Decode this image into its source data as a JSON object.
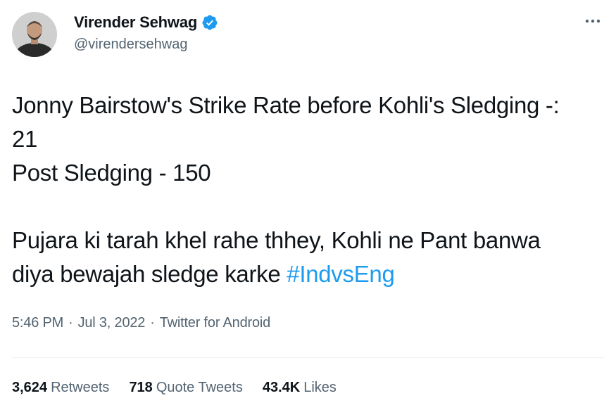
{
  "author": {
    "display_name": "Virender Sehwag",
    "handle": "@virendersehwag",
    "verified_icon": "verified-badge-icon",
    "brand_color": "#1d9bf0"
  },
  "tweet": {
    "lines": [
      "Jonny Bairstow's Strike Rate before Kohli's Sledging -:",
      "21",
      "Post Sledging - 150"
    ],
    "line4": "Pujara ki tarah khel rahe thhey, Kohli ne Pant banwa",
    "line5_text": "diya bewajah sledge karke ",
    "hashtag": "#IndvsEng"
  },
  "meta": {
    "time": "5:46 PM",
    "separator": "·",
    "date": "Jul 3, 2022",
    "source": "Twitter for Android"
  },
  "stats": {
    "retweets_count": "3,624",
    "retweets_label": "Retweets",
    "quotes_count": "718",
    "quotes_label": "Quote Tweets",
    "likes_count": "43.4K",
    "likes_label": "Likes"
  },
  "icons": {
    "more": "more-options-icon",
    "avatar": "avatar"
  }
}
